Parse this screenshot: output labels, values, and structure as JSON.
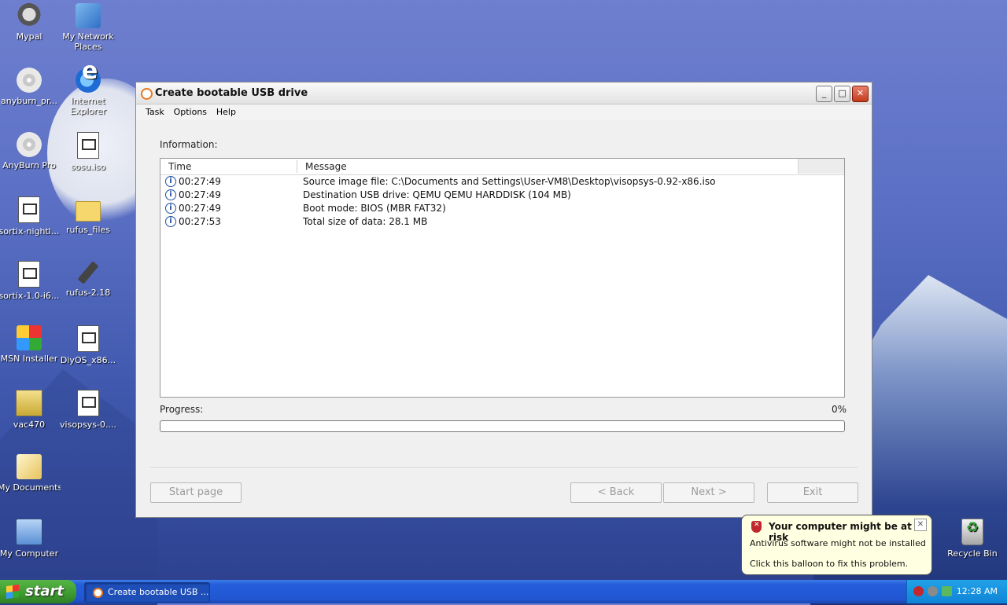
{
  "desktop": {
    "icons": [
      {
        "label": "Mypal"
      },
      {
        "label": "My Network Places"
      },
      {
        "label": "anyburn_pr..."
      },
      {
        "label": "Internet Explorer"
      },
      {
        "label": "AnyBurn Pro"
      },
      {
        "label": "sosu.iso"
      },
      {
        "label": "sortix-nightl..."
      },
      {
        "label": "rufus_files"
      },
      {
        "label": "sortix-1.0-i6..."
      },
      {
        "label": "rufus-2.18"
      },
      {
        "label": "MSN Installer"
      },
      {
        "label": "DiyOS_x86..."
      },
      {
        "label": "vac470"
      },
      {
        "label": "visopsys-0...."
      },
      {
        "label": "My Documents"
      },
      {
        "label": "My Computer"
      },
      {
        "label": "Recycle Bin"
      }
    ]
  },
  "window": {
    "title": "Create bootable USB drive",
    "buttons": {
      "minimize": "_",
      "maximize": "□",
      "close": "✕"
    },
    "menu": [
      "Task",
      "Options",
      "Help"
    ],
    "information_label": "Information:",
    "columns": {
      "time": "Time",
      "message": "Message"
    },
    "log": [
      {
        "time": "00:27:49",
        "message": "Source image file: C:\\Documents and Settings\\User-VM8\\Desktop\\visopsys-0.92-x86.iso"
      },
      {
        "time": "00:27:49",
        "message": "Destination USB drive: QEMU QEMU HARDDISK (104 MB)"
      },
      {
        "time": "00:27:49",
        "message": "Boot mode: BIOS (MBR FAT32)"
      },
      {
        "time": "00:27:53",
        "message": "Total size of data: 28.1 MB"
      }
    ],
    "progress_label": "Progress:",
    "progress_text": "0%",
    "progress_value": 0,
    "buttons_bottom": {
      "start_page": "Start page",
      "back": "< Back",
      "next": "Next >",
      "exit": "Exit"
    }
  },
  "balloon": {
    "title": "Your computer might be at risk",
    "line1": "Antivirus software might not be installed",
    "line2": "Click this balloon to fix this problem.",
    "close": "✕"
  },
  "taskbar": {
    "start_label": "start",
    "task_button": "Create bootable USB ...",
    "clock": "12:28 AM"
  }
}
